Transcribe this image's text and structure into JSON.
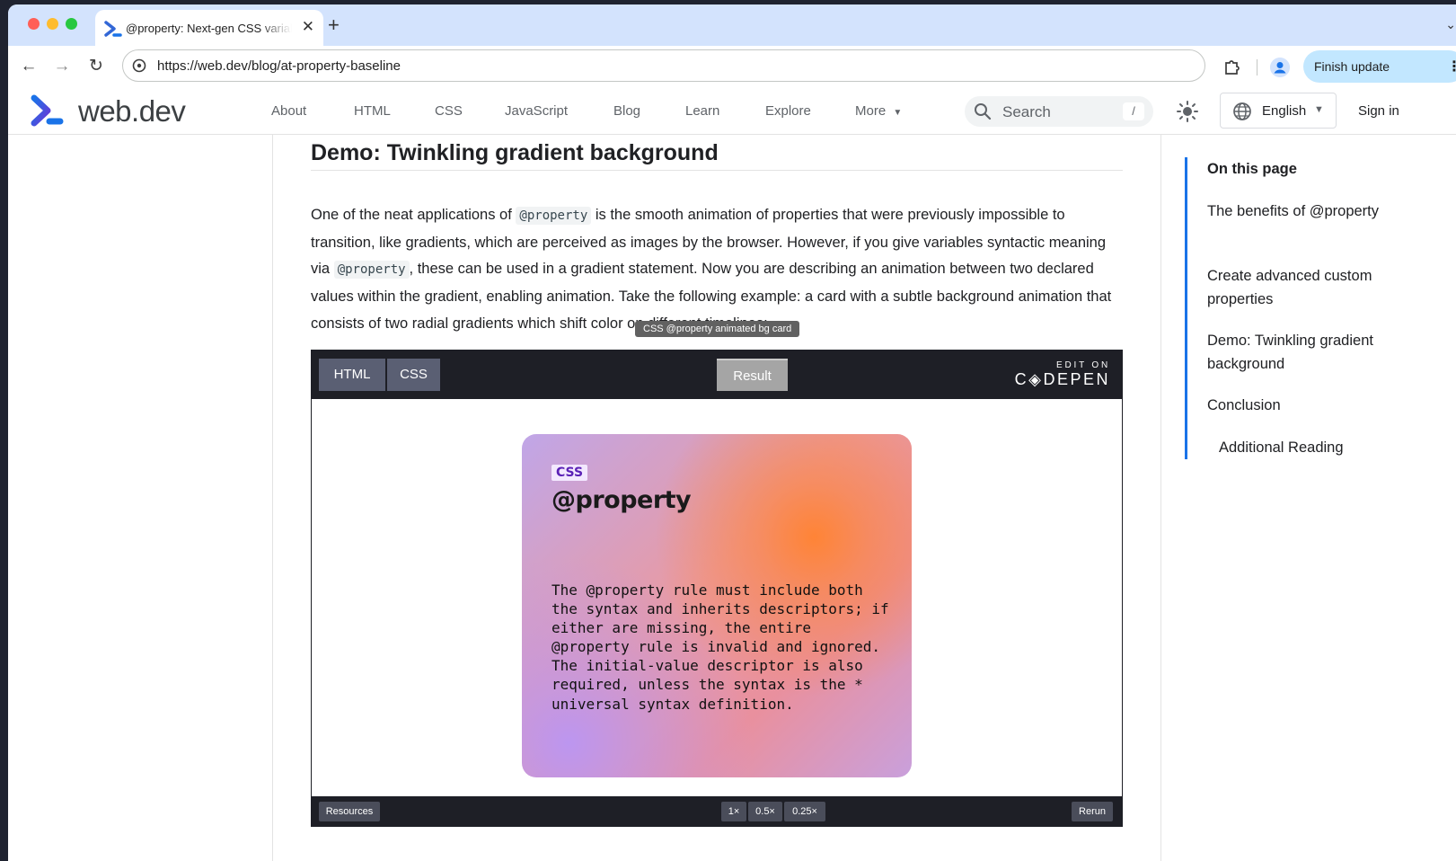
{
  "browser": {
    "tab_title": "@property: Next-gen CSS variables",
    "tab_close": "✕",
    "new_tab": "+",
    "url": "https://web.dev/blog/at-property-baseline",
    "finish_update": "Finish update"
  },
  "site": {
    "logo_text": "web.dev",
    "nav": [
      "About",
      "HTML",
      "CSS",
      "JavaScript",
      "Blog",
      "Learn",
      "Explore",
      "More"
    ],
    "search_placeholder": "Search",
    "search_shortcut": "/",
    "language": "English",
    "sign_in": "Sign in"
  },
  "article": {
    "heading": "Demo: Twinkling gradient background",
    "para_parts": [
      "One of the neat applications of ",
      "@property",
      " is the smooth animation of properties that were previously impossible to transition, like gradients, which are perceived as images by the browser. However, if you give variables syntactic meaning via ",
      "@property",
      ", these can be used in a gradient statement. Now you are describing an animation between two declared values within the gradient, enabling animation. Take the following example: a card with a subtle background animation that consists of two radial gradients which shift color on different timelines:"
    ],
    "tooltip": "CSS @property animated bg card"
  },
  "embed": {
    "tabs": [
      "HTML",
      "CSS"
    ],
    "result_tab": "Result",
    "edit_on": "EDIT ON",
    "codepen": "C◈DEPEN",
    "card_badge": "CSS",
    "card_title": "@property",
    "card_text": "The @property rule must include both the syntax and inherits descriptors; if either are missing, the entire @property rule is invalid and ignored. The initial-value descriptor is also required, unless the syntax is the * universal syntax definition.",
    "resources": "Resources",
    "zoom": [
      "1×",
      "0.5×",
      "0.25×"
    ],
    "rerun": "Rerun"
  },
  "toc": {
    "title": "On this page",
    "items": [
      "The benefits of @property",
      "Create advanced custom properties",
      "Demo: Twinkling gradient background",
      "Conclusion",
      "Additional Reading"
    ]
  },
  "colors": {
    "tab_strip": "#d3e3fd",
    "accent": "#1a73e8",
    "codepen_bar": "#1e1f26"
  }
}
